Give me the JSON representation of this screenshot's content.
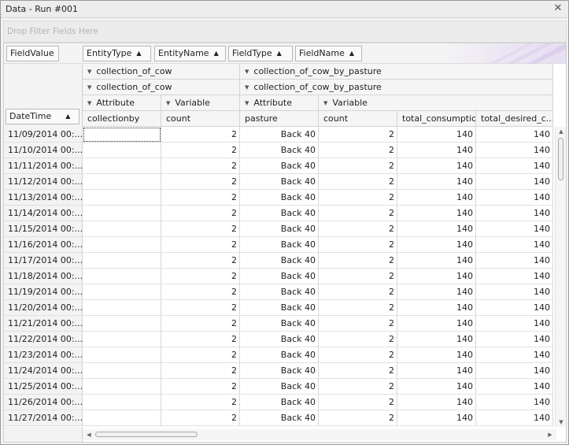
{
  "window": {
    "title": "Data - Run #001"
  },
  "filter_area": {
    "placeholder": "Drop Filter Fields Here"
  },
  "fields": {
    "data_field": "FieldValue",
    "column_fields": [
      "EntityType",
      "EntityName",
      "FieldType",
      "FieldName"
    ],
    "row_field": "DateTime"
  },
  "column_headers": {
    "entity_type": [
      "collection_of_cow",
      "collection_of_cow_by_pasture"
    ],
    "entity_name": [
      "collection_of_cow",
      "collection_of_cow_by_pasture"
    ],
    "field_type": [
      "Attribute",
      "Variable",
      "Attribute",
      "Variable"
    ],
    "field_name": [
      "collectionby",
      "count",
      "pasture",
      "count",
      "total_consumption",
      "total_desired_c..."
    ]
  },
  "rows": [
    {
      "date": "11/09/2014 00:...",
      "values": [
        "",
        "2",
        "Back 40",
        "2",
        "140",
        "140"
      ]
    },
    {
      "date": "11/10/2014 00:...",
      "values": [
        "",
        "2",
        "Back 40",
        "2",
        "140",
        "140"
      ]
    },
    {
      "date": "11/11/2014 00:...",
      "values": [
        "",
        "2",
        "Back 40",
        "2",
        "140",
        "140"
      ]
    },
    {
      "date": "11/12/2014 00:...",
      "values": [
        "",
        "2",
        "Back 40",
        "2",
        "140",
        "140"
      ]
    },
    {
      "date": "11/13/2014 00:...",
      "values": [
        "",
        "2",
        "Back 40",
        "2",
        "140",
        "140"
      ]
    },
    {
      "date": "11/14/2014 00:...",
      "values": [
        "",
        "2",
        "Back 40",
        "2",
        "140",
        "140"
      ]
    },
    {
      "date": "11/15/2014 00:...",
      "values": [
        "",
        "2",
        "Back 40",
        "2",
        "140",
        "140"
      ]
    },
    {
      "date": "11/16/2014 00:...",
      "values": [
        "",
        "2",
        "Back 40",
        "2",
        "140",
        "140"
      ]
    },
    {
      "date": "11/17/2014 00:...",
      "values": [
        "",
        "2",
        "Back 40",
        "2",
        "140",
        "140"
      ]
    },
    {
      "date": "11/18/2014 00:...",
      "values": [
        "",
        "2",
        "Back 40",
        "2",
        "140",
        "140"
      ]
    },
    {
      "date": "11/19/2014 00:...",
      "values": [
        "",
        "2",
        "Back 40",
        "2",
        "140",
        "140"
      ]
    },
    {
      "date": "11/20/2014 00:...",
      "values": [
        "",
        "2",
        "Back 40",
        "2",
        "140",
        "140"
      ]
    },
    {
      "date": "11/21/2014 00:...",
      "values": [
        "",
        "2",
        "Back 40",
        "2",
        "140",
        "140"
      ]
    },
    {
      "date": "11/22/2014 00:...",
      "values": [
        "",
        "2",
        "Back 40",
        "2",
        "140",
        "140"
      ]
    },
    {
      "date": "11/23/2014 00:...",
      "values": [
        "",
        "2",
        "Back 40",
        "2",
        "140",
        "140"
      ]
    },
    {
      "date": "11/24/2014 00:...",
      "values": [
        "",
        "2",
        "Back 40",
        "2",
        "140",
        "140"
      ]
    },
    {
      "date": "11/25/2014 00:...",
      "values": [
        "",
        "2",
        "Back 40",
        "2",
        "140",
        "140"
      ]
    },
    {
      "date": "11/26/2014 00:...",
      "values": [
        "",
        "2",
        "Back 40",
        "2",
        "140",
        "140"
      ]
    },
    {
      "date": "11/27/2014 00:...",
      "values": [
        "",
        "2",
        "Back 40",
        "2",
        "140",
        "140"
      ]
    }
  ],
  "icons": {
    "close": "close-icon",
    "sort_asc": "sort-ascending-icon",
    "collapse": "collapse-triangle-icon"
  },
  "colors": {
    "header_bg": "#f5f5f5",
    "grid_line": "#d8d8d8",
    "accent_deco": "#e6def2"
  }
}
